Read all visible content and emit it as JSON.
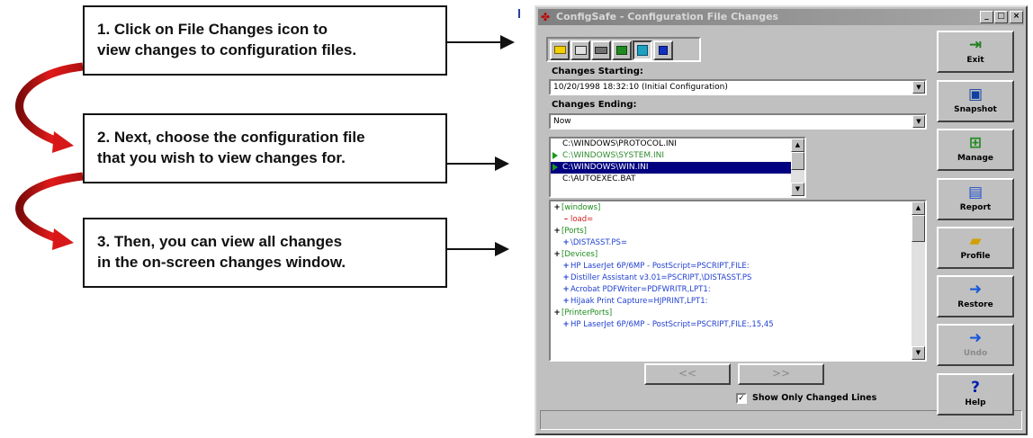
{
  "instructions": [
    {
      "lines": [
        "1. Click on File Changes icon to",
        "view changes to configuration files."
      ]
    },
    {
      "lines": [
        "2. Next, choose the configuration file",
        "that you wish to view changes for."
      ]
    },
    {
      "lines": [
        "3. Then, you can view all changes",
        "in the on-screen changes window."
      ]
    }
  ],
  "window": {
    "title": "ConfigSafe - Configuration File Changes",
    "controls": {
      "minimize": "_",
      "maximize": "□",
      "close": "×"
    }
  },
  "toolbar": {
    "icons": [
      "folder-icon",
      "printer-icon",
      "keyboard-icon",
      "network-icon",
      "file-changes-icon",
      "lock-icon"
    ]
  },
  "changes_starting": {
    "label": "Changes Starting:",
    "value": "10/20/1998 18:32:10 (Initial Configuration)"
  },
  "changes_ending": {
    "label": "Changes Ending:",
    "value": "Now"
  },
  "files": [
    {
      "name": "C:\\WINDOWS\\PROTOCOL.INI",
      "state": "normal"
    },
    {
      "name": "C:\\WINDOWS\\SYSTEM.INI",
      "state": "changed"
    },
    {
      "name": "C:\\WINDOWS\\WIN.INI",
      "state": "selected"
    },
    {
      "name": "C:\\AUTOEXEC.BAT",
      "state": "normal"
    }
  ],
  "changes": [
    {
      "text": "[windows]",
      "kind": "section",
      "mark": "+"
    },
    {
      "text": "load=",
      "kind": "removed",
      "mark": "–"
    },
    {
      "text": "[Ports]",
      "kind": "section",
      "mark": "+"
    },
    {
      "text": "\\DISTASST.PS=",
      "kind": "added",
      "mark": "+"
    },
    {
      "text": "[Devices]",
      "kind": "section",
      "mark": "+"
    },
    {
      "text": "HP LaserJet 6P/6MP - PostScript=PSCRIPT,FILE:",
      "kind": "added",
      "mark": "+"
    },
    {
      "text": "Distiller Assistant v3.01=PSCRIPT,\\DISTASST.PS",
      "kind": "added",
      "mark": "+"
    },
    {
      "text": "Acrobat PDFWriter=PDFWRITR,LPT1:",
      "kind": "added",
      "mark": "+"
    },
    {
      "text": "HiJaak Print Capture=HJPRINT,LPT1:",
      "kind": "added",
      "mark": "+"
    },
    {
      "text": "[PrinterPorts]",
      "kind": "section",
      "mark": "+"
    },
    {
      "text": "HP LaserJet 6P/6MP - PostScript=PSCRIPT,FILE:,15,45",
      "kind": "added",
      "mark": "+"
    }
  ],
  "nav": {
    "prev": "<<",
    "next": ">>"
  },
  "show_only_changed": {
    "label": "Show Only Changed Lines",
    "checked": true,
    "mark": "✓"
  },
  "side_buttons": [
    {
      "label": "Exit",
      "icon": "exit-icon",
      "glyph": "⇥",
      "enabled": true
    },
    {
      "label": "Snapshot",
      "icon": "camera-icon",
      "glyph": "▣",
      "enabled": true
    },
    {
      "label": "Manage",
      "icon": "network-icon",
      "glyph": "⊞",
      "enabled": true
    },
    {
      "label": "Report",
      "icon": "report-icon",
      "glyph": "▤",
      "enabled": true
    },
    {
      "label": "Profile",
      "icon": "profile-icon",
      "glyph": "▰",
      "enabled": true
    },
    {
      "label": "Restore",
      "icon": "restore-icon",
      "glyph": "➜",
      "enabled": true
    },
    {
      "label": "Undo",
      "icon": "undo-icon",
      "glyph": "➜",
      "enabled": false
    },
    {
      "label": "Help",
      "icon": "help-icon",
      "glyph": "?",
      "enabled": true
    }
  ],
  "colors": {
    "section": "#1a8a1a",
    "removed": "#d02020",
    "added": "#1f3fd0",
    "selection": "#000080",
    "callout_curve": "#d81818"
  }
}
